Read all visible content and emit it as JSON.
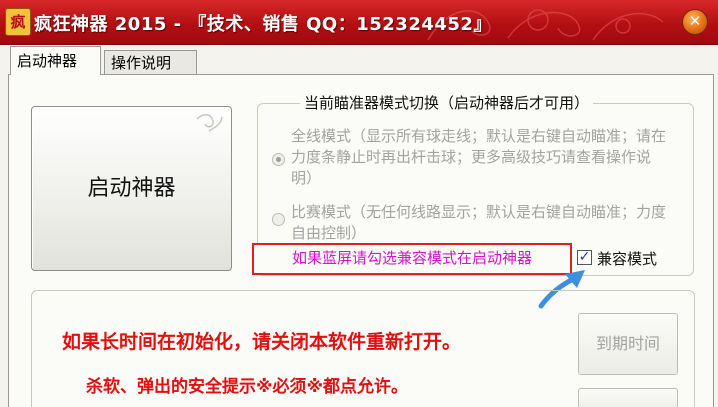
{
  "window": {
    "title": "疯狂神器 2015 - 『技术、销售 QQ：152324452』",
    "icon_label": "疯",
    "close_label": "✕",
    "colors": {
      "titlebar": "#c41518",
      "notice": "#e01010",
      "hint_text": "#d514d0",
      "hint_border": "#e02020"
    }
  },
  "tabs": [
    {
      "label": "启动神器",
      "active": true
    },
    {
      "label": "操作说明",
      "active": false
    }
  ],
  "start_button": {
    "label": "启动神器"
  },
  "mode_group": {
    "legend": "当前瞄准器模式切换（启动神器后才可用）",
    "modes": [
      {
        "text": "全线模式（显示所有球走线；默认是右键自动瞄准；请在力度条静止时再出杆击球；更多高级技巧请查看操作说明）",
        "checked": true,
        "enabled": false
      },
      {
        "text": "比赛模式（无任何线路显示；默认是右键自动瞄准；力度自由控制）",
        "checked": false,
        "enabled": false
      }
    ]
  },
  "hint": {
    "text": "如果蓝屏请勾选兼容模式在启动神器"
  },
  "compat": {
    "label": "兼容模式",
    "checked": true,
    "check_glyph": "✓"
  },
  "notices": {
    "line1": "如果长时间在初始化，请关闭本软件重新打开。",
    "line2": "杀软、弹出的安全提示※必须※都点允许。"
  },
  "expire_button": {
    "label": "到期时间",
    "enabled": false
  }
}
